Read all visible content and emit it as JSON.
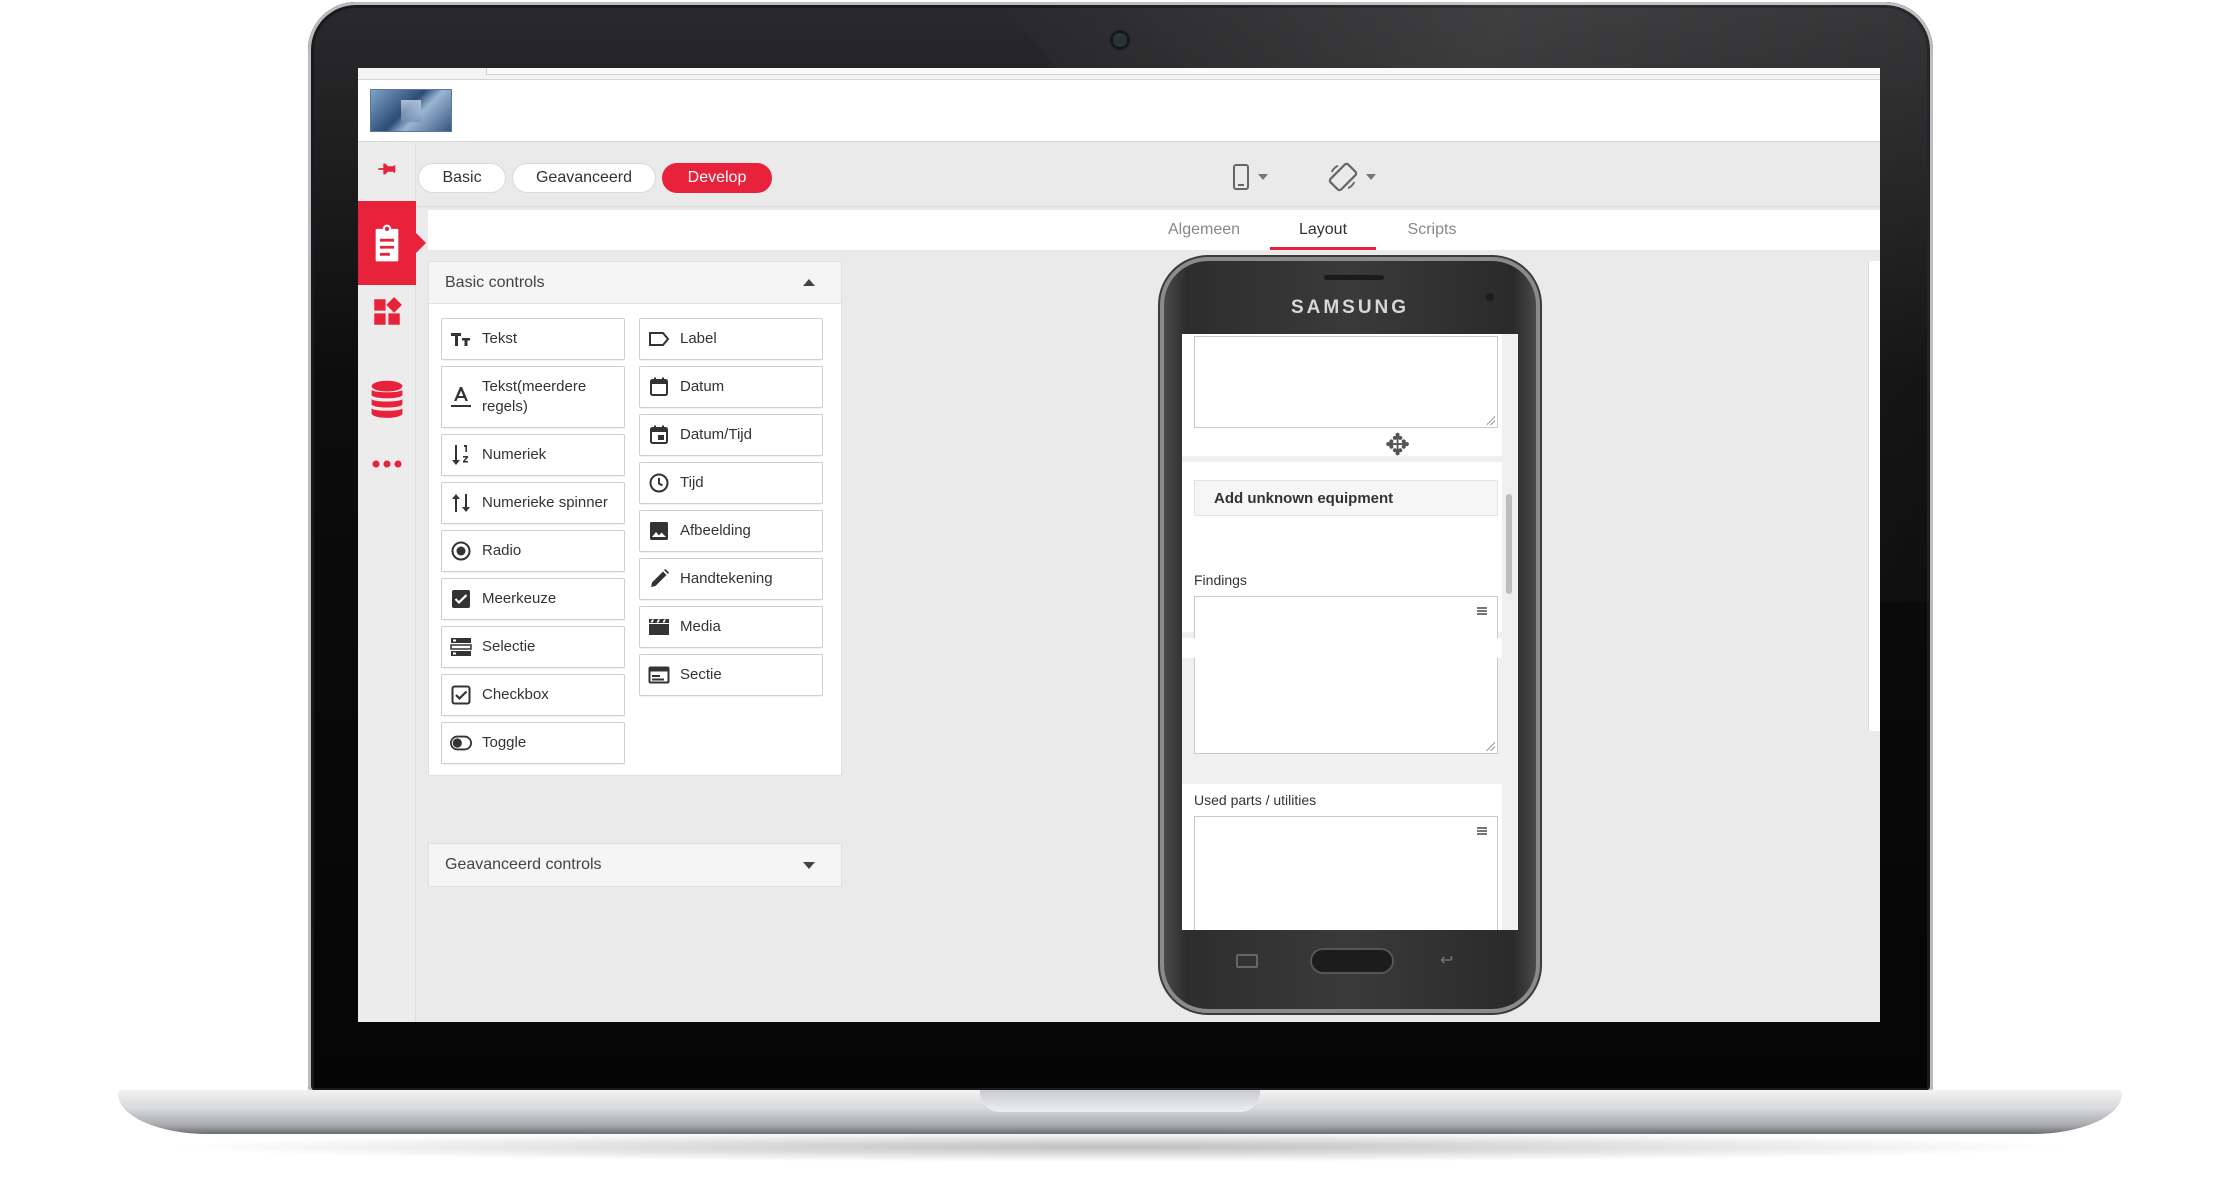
{
  "toolbar": {
    "modes": [
      "Basic",
      "Geavanceerd",
      "Develop"
    ],
    "active_mode": "Develop",
    "device_icon": "smartphone-icon",
    "rotate_icon": "rotate-icon"
  },
  "rail": {
    "items": [
      {
        "name": "pin",
        "icon": "pin-icon"
      },
      {
        "name": "forms",
        "icon": "clipboard-icon",
        "active": true
      },
      {
        "name": "widgets",
        "icon": "widgets-icon"
      },
      {
        "name": "database",
        "icon": "database-icon"
      },
      {
        "name": "more",
        "icon": "more-icon"
      }
    ]
  },
  "tabs": {
    "items": [
      "Algemeen",
      "Layout",
      "Scripts"
    ],
    "active": "Layout"
  },
  "basic_controls": {
    "title": "Basic controls",
    "left": [
      {
        "label": "Tekst",
        "icon": "text-size-icon"
      },
      {
        "label": "Tekst(meerdere regels)",
        "icon": "text-multiline-icon"
      },
      {
        "label": "Numeriek",
        "icon": "sort-numeric-icon"
      },
      {
        "label": "Numerieke spinner",
        "icon": "spinner-arrows-icon"
      },
      {
        "label": "Radio",
        "icon": "radio-icon"
      },
      {
        "label": "Meerkeuze",
        "icon": "checkbox-checked-icon"
      },
      {
        "label": "Selectie",
        "icon": "list-select-icon"
      },
      {
        "label": "Checkbox",
        "icon": "checkbox-outline-icon"
      },
      {
        "label": "Toggle",
        "icon": "toggle-icon"
      }
    ],
    "right": [
      {
        "label": "Label",
        "icon": "label-tag-icon"
      },
      {
        "label": "Datum",
        "icon": "calendar-icon"
      },
      {
        "label": "Datum/Tijd",
        "icon": "calendar-time-icon"
      },
      {
        "label": "Tijd",
        "icon": "clock-icon"
      },
      {
        "label": "Afbeelding",
        "icon": "image-icon"
      },
      {
        "label": "Handtekening",
        "icon": "pen-icon"
      },
      {
        "label": "Media",
        "icon": "clapperboard-icon"
      },
      {
        "label": "Sectie",
        "icon": "section-icon"
      }
    ]
  },
  "advanced_controls": {
    "title": "Geavanceerd controls"
  },
  "phone": {
    "brand": "SAMSUNG",
    "section_title": "Add unknown equipment",
    "fields": [
      "Findings",
      "Used parts / utilities"
    ]
  },
  "colors": {
    "accent": "#e8223a",
    "background": "#eaeaea"
  }
}
